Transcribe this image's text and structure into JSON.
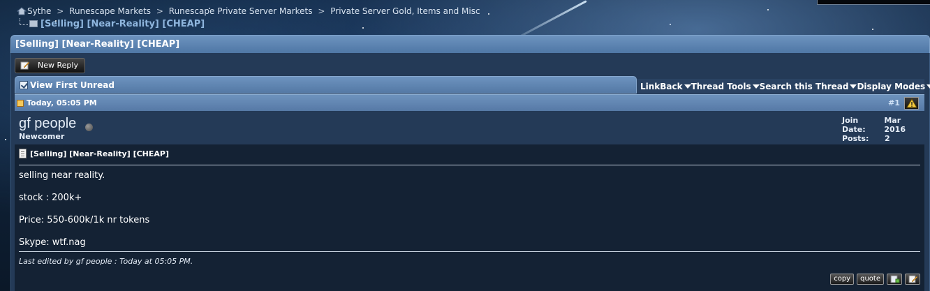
{
  "breadcrumb": {
    "items": [
      "Sythe",
      "Runescape Markets",
      "Runescape Private Server Markets",
      "Private Server Gold, Items and Misc"
    ],
    "separator": ">",
    "current": "[Selling] [Near-Reality] [CHEAP]"
  },
  "thread": {
    "title": "[Selling] [Near-Reality] [CHEAP]",
    "new_reply_label": "New Reply",
    "view_first_unread_label": "View First Unread",
    "tools": [
      "LinkBack",
      "Thread Tools",
      "Search this Thread",
      "Display Modes"
    ]
  },
  "post": {
    "date": "Today, 05:05 PM",
    "number": "#1",
    "username": "gf people",
    "user_title": "Newcomer",
    "join_date_label": "Join Date:",
    "join_date": "Mar 2016",
    "posts_label": "Posts:",
    "posts": "2",
    "title": "[Selling] [Near-Reality] [CHEAP]",
    "lines": [
      "selling near reality.",
      "stock : 200k+",
      "Price: 550-600k/1k nr tokens",
      "Skype: wtf.nag"
    ],
    "edited_note": "Last edited by gf people : Today at 05:05 PM.",
    "copy_label": "copy",
    "quote_label": "quote"
  },
  "colors": {
    "header_blue": "#5f86b3",
    "panel_bg": "#243a57",
    "post_bg": "#142234",
    "link_blue": "#8fb6de"
  }
}
